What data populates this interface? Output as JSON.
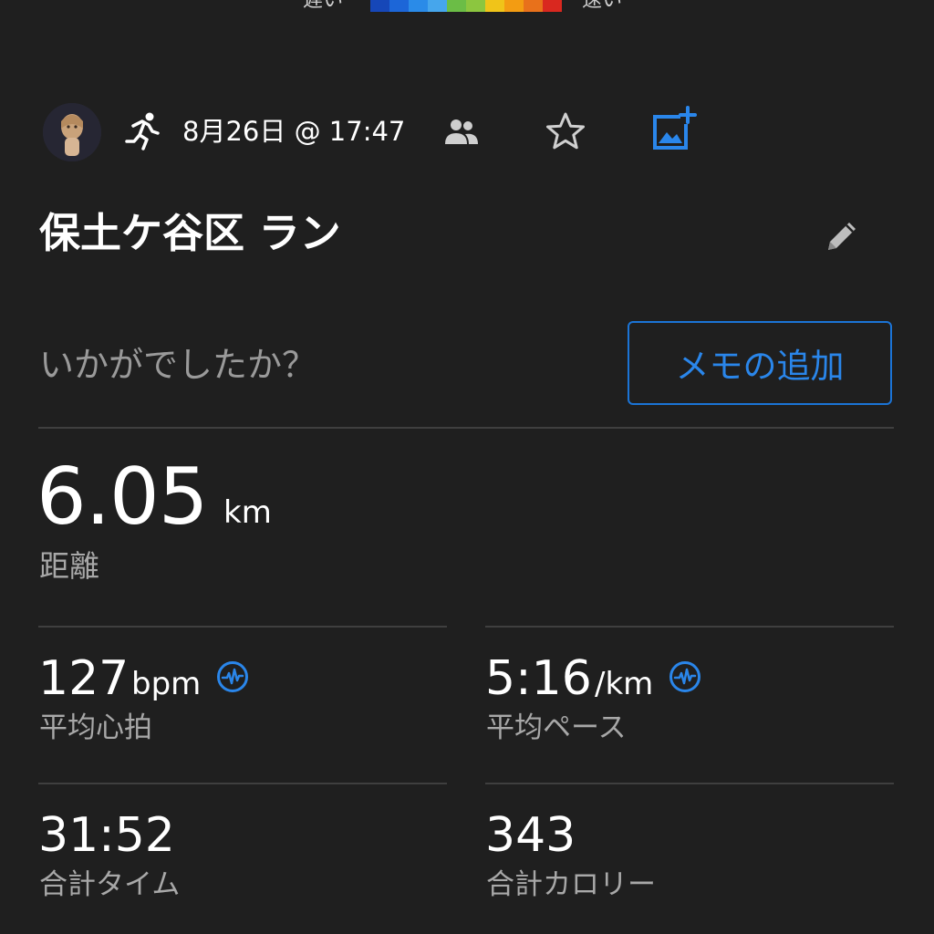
{
  "pace_legend": {
    "slow_label": "遅い",
    "fast_label": "速い",
    "colors": [
      "#1647b8",
      "#1c66d8",
      "#2a8be8",
      "#46a6ec",
      "#6bbd46",
      "#8cc63f",
      "#f0c419",
      "#f39c12",
      "#e8711b",
      "#d9281f"
    ]
  },
  "activity": {
    "type_icon": "running-icon",
    "date_time": "8月26日 @ 17:47",
    "title": "保土ケ谷区 ラン",
    "prompt": "いかがでしたか？",
    "memo_button_label": "メモの追加"
  },
  "distance": {
    "value": "6.05",
    "unit": "km",
    "label": "距離"
  },
  "stats": {
    "avg_hr": {
      "value": "127",
      "unit": "bpm",
      "label": "平均心拍"
    },
    "avg_pace": {
      "value": "5:16",
      "unit": "/km",
      "label": "平均ペース"
    },
    "total_time": {
      "value": "31:52",
      "label": "合計タイム"
    },
    "total_calories": {
      "value": "343",
      "label": "合計カロリー"
    }
  },
  "colors": {
    "background": "#1f1f1f",
    "accent": "#2a86ea",
    "divider": "#3f3f3f",
    "secondary_text": "#a8a8a8"
  }
}
